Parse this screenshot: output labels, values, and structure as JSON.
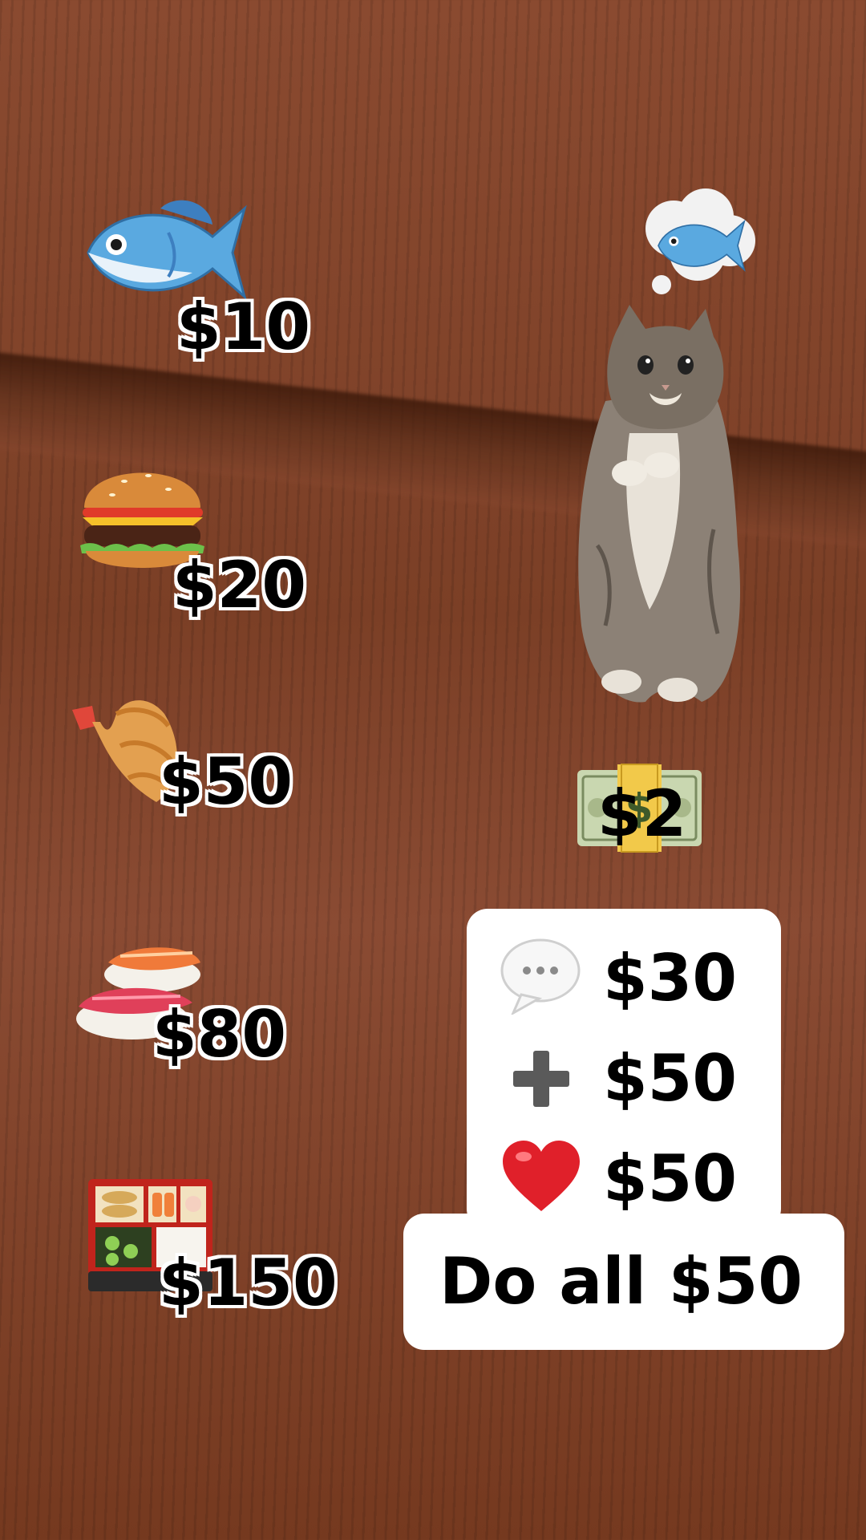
{
  "menu": [
    {
      "icon": "fish-icon",
      "price": "$10"
    },
    {
      "icon": "hamburger-icon",
      "price": "$20"
    },
    {
      "icon": "fried-shrimp-icon",
      "price": "$50"
    },
    {
      "icon": "sushi-icon",
      "price": "$80"
    },
    {
      "icon": "bento-box-icon",
      "price": "$150"
    }
  ],
  "cat": {
    "thought_icon": "fish-icon",
    "money_icon": "dollar-banknote-icon",
    "money_price": "$2"
  },
  "actions": {
    "comment": {
      "icon": "speech-bubble-icon",
      "price": "$30"
    },
    "follow": {
      "icon": "plus-icon",
      "price": "$50"
    },
    "like": {
      "icon": "red-heart-icon",
      "price": "$50"
    },
    "all_label": "Do all $50"
  },
  "colors": {
    "wood": "#7b3f26",
    "card": "#ffffff",
    "text": "#000000",
    "heart": "#e0202a"
  }
}
